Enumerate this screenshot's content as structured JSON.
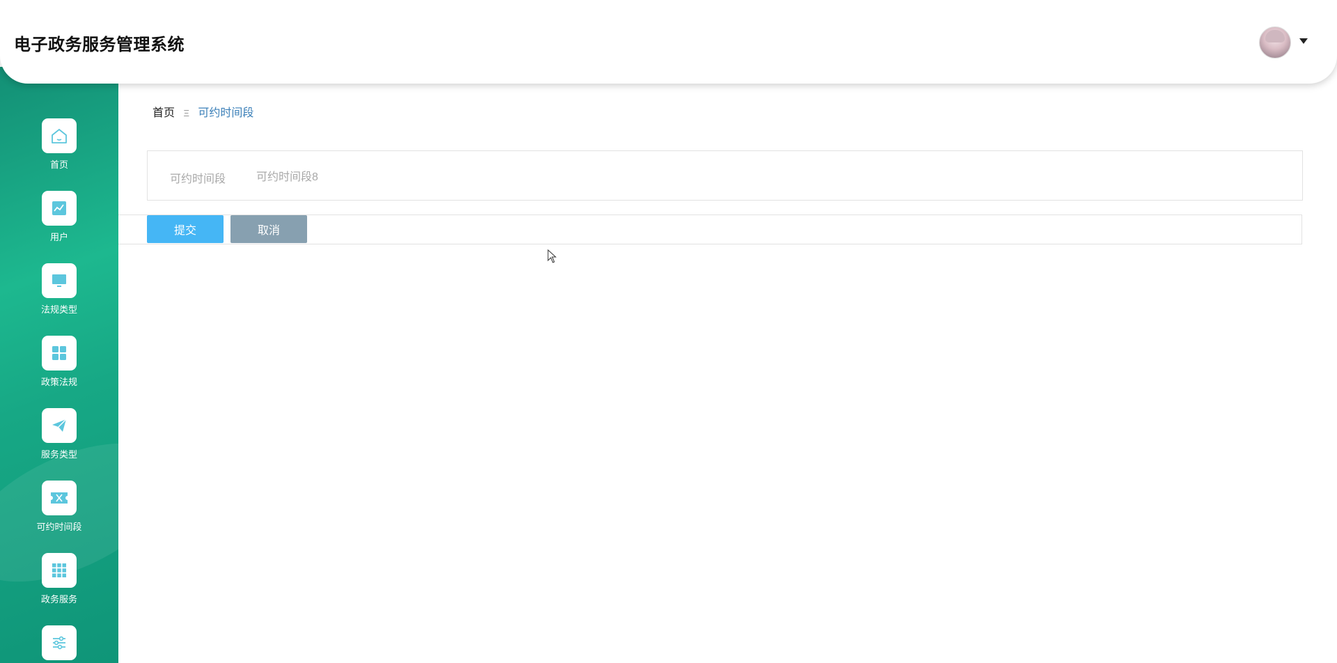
{
  "header": {
    "title": "电子政务服务管理系统"
  },
  "sidebar": {
    "items": [
      {
        "label": "首页",
        "icon": "home-icon"
      },
      {
        "label": "用户",
        "icon": "chart-line-icon"
      },
      {
        "label": "法规类型",
        "icon": "monitor-icon"
      },
      {
        "label": "政策法规",
        "icon": "grid-icon"
      },
      {
        "label": "服务类型",
        "icon": "paper-plane-icon"
      },
      {
        "label": "可约时间段",
        "icon": "ticket-icon"
      },
      {
        "label": "政务服务",
        "icon": "apps-grid-icon"
      },
      {
        "label": "",
        "icon": "sliders-icon"
      }
    ]
  },
  "breadcrumb": {
    "home": "首页",
    "separator": "Ξ",
    "current": "可约时间段"
  },
  "form": {
    "field_label": "可约时间段",
    "field_value": "可约时间段8"
  },
  "buttons": {
    "submit": "提交",
    "cancel": "取消"
  },
  "colors": {
    "sidebar": "#1db88f",
    "primary_button": "#45b6f5",
    "secondary_button": "#87a0b0",
    "breadcrumb_active": "#3a7fb8",
    "icon": "#5cc6dd"
  }
}
